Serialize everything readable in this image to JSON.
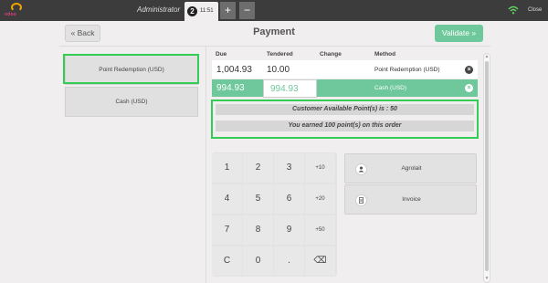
{
  "app": {
    "brand": "odoo"
  },
  "topbar": {
    "user": "Administrator",
    "order_number": "2",
    "order_time": "11:51",
    "add_label": "+",
    "remove_label": "−",
    "close_label": "Close"
  },
  "header": {
    "back_label": "« Back",
    "title": "Payment",
    "validate_label": "Validate »"
  },
  "payment_methods": [
    {
      "label": "Point Redemption (USD)",
      "highlighted": true
    },
    {
      "label": "Cash (USD)",
      "highlighted": false
    }
  ],
  "paymentlines": {
    "columns": [
      "Due",
      "Tendered",
      "Change",
      "Method"
    ],
    "rows": [
      {
        "due": "1,004.93",
        "tendered": "10.00",
        "change": "",
        "method": "Point Redemption (USD)",
        "selected": false
      },
      {
        "due": "994.93",
        "tendered": "994.93",
        "change": "",
        "method": "Cash (USD)",
        "selected": true
      }
    ]
  },
  "points": {
    "available": "Customer Available Point(s) is : 50",
    "earned": "You earned 100 point(s) on this order"
  },
  "numpad": {
    "keys": [
      "1",
      "2",
      "3",
      "+10",
      "4",
      "5",
      "6",
      "+20",
      "7",
      "8",
      "9",
      "+50",
      "C",
      "0",
      ".",
      "⌫"
    ]
  },
  "customer": {
    "label": "Agrolait",
    "icon": "user-icon"
  },
  "invoice": {
    "label": "Invoice",
    "icon": "document-icon"
  },
  "colors": {
    "accent": "#6ec89b",
    "highlight": "#33cc55",
    "topbar": "#3c3c3c"
  }
}
